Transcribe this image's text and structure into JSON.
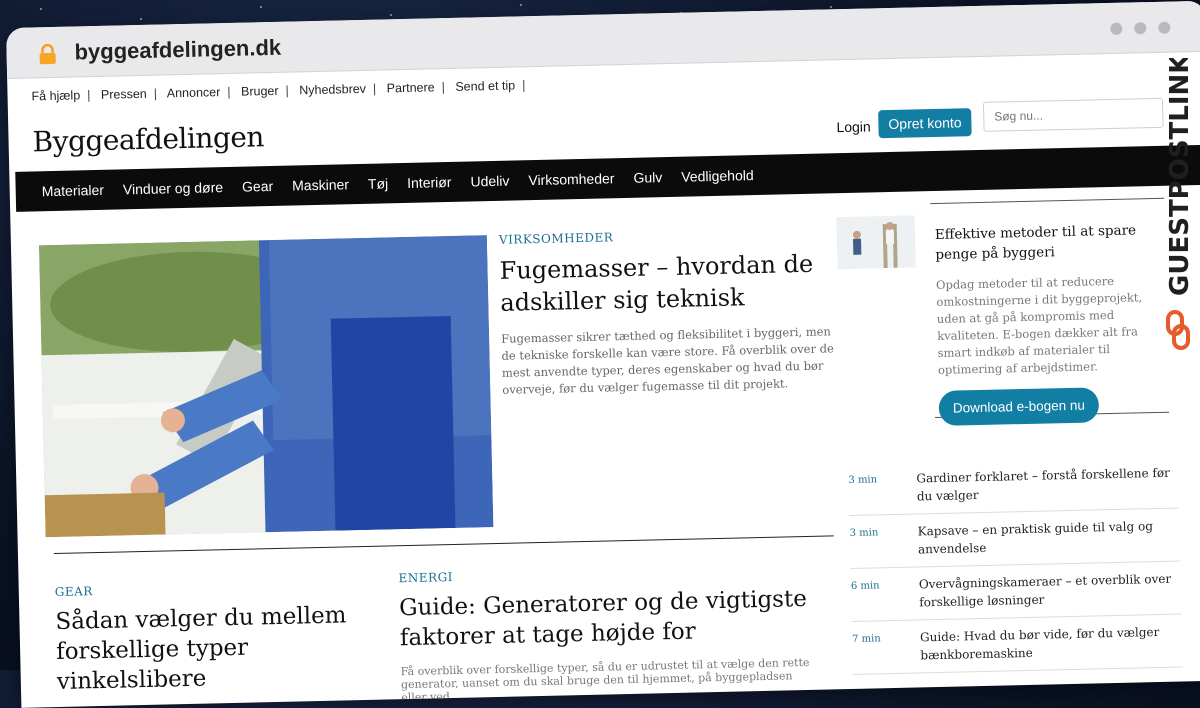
{
  "browser": {
    "url": "byggeafdelingen.dk"
  },
  "topbar": {
    "links": [
      "Få hjælp",
      "Pressen",
      "Annoncer",
      "Bruger",
      "Nyhedsbrev",
      "Partnere",
      "Send et tip"
    ]
  },
  "header": {
    "logo": "Byggeafdelingen",
    "login": "Login",
    "signup": "Opret konto",
    "search_placeholder": "Søg nu..."
  },
  "nav": {
    "items": [
      "Materialer",
      "Vinduer og døre",
      "Gear",
      "Maskiner",
      "Tøj",
      "Interiør",
      "Udeliv",
      "Virksomheder",
      "Gulv",
      "Vedligehold"
    ]
  },
  "hero": {
    "category": "VIRKSOMHEDER",
    "title": "Fugemasser – hvordan de adskiller sig teknisk",
    "excerpt": "Fugemasser sikrer tæthed og fleksibilitet i byggeri, men de tekniske forskelle kan være store. Få overblik over de mest anvendte typer, deres egenskaber og hvad du bør overveje, før du vælger fugemasse til dit projekt."
  },
  "promo": {
    "title": "Effektive metoder til at spare penge på byggeri",
    "text": "Opdag metoder til at reducere omkostningerne i dit byggeprojekt, uden at gå på kompromis med kvaliteten. E-bogen dækker alt fra smart indkøb af materialer til optimering af arbejdstimer.",
    "button": "Download e-bogen nu"
  },
  "sidebar_list": [
    {
      "time": "3 min",
      "title": "Gardiner forklaret – forstå forskellene før du vælger"
    },
    {
      "time": "3 min",
      "title": "Kapsave – en praktisk guide til valg og anvendelse"
    },
    {
      "time": "6 min",
      "title": "Overvågningskameraer – et overblik over forskellige løsninger"
    },
    {
      "time": "7 min",
      "title": "Guide: Hvad du bør vide, før du vælger bænkboremaskine"
    }
  ],
  "cards": [
    {
      "category": "GEAR",
      "title": "Sådan vælger du mellem forskellige typer vinkelslibere"
    },
    {
      "category": "ENERGI",
      "title": "Guide: Generatorer og de vigtigste faktorer at tage højde for",
      "excerpt": "Få overblik over forskellige typer, så du er udrustet til at vælge den rette generator, uanset om du skal bruge den til hjemmet, på byggepladsen eller ved"
    }
  ],
  "watermark": {
    "text": "GUESTPOSTLINKS"
  },
  "colors": {
    "accent": "#137ea3",
    "nav_bg": "#0b0b0b",
    "category": "#1a6f8f"
  }
}
